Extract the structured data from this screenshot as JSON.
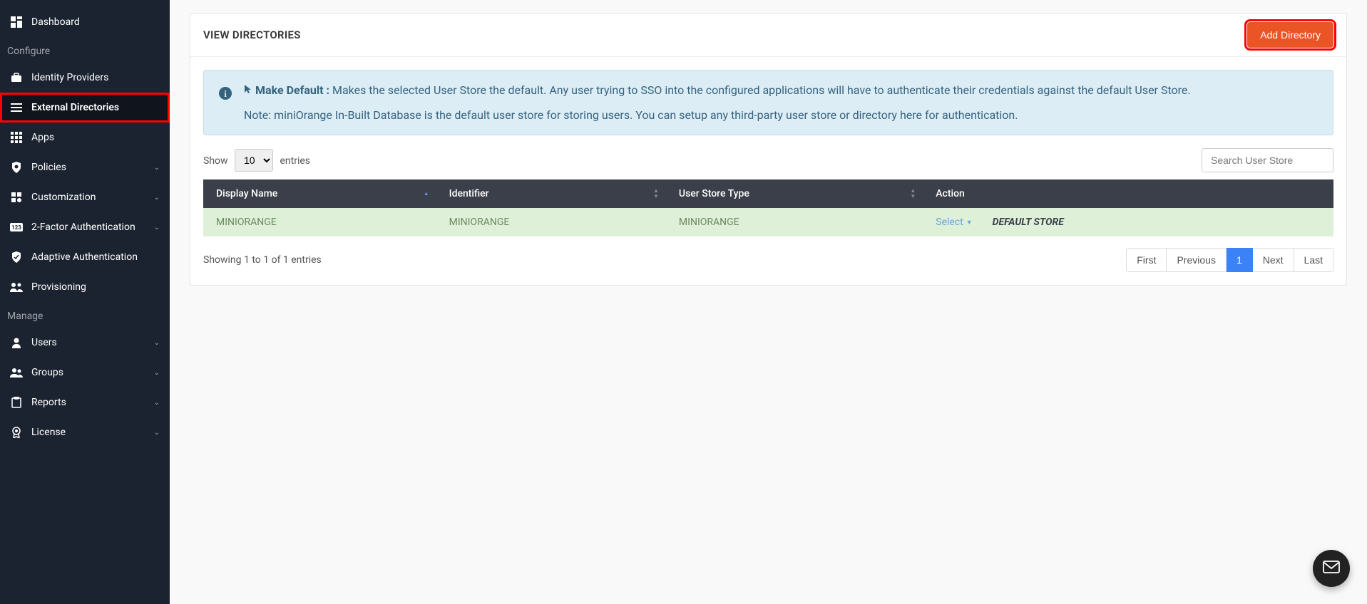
{
  "sidebar": {
    "dashboard": "Dashboard",
    "section_configure": "Configure",
    "section_manage": "Manage",
    "items": {
      "identity_providers": "Identity Providers",
      "external_directories": "External Directories",
      "apps": "Apps",
      "policies": "Policies",
      "customization": "Customization",
      "two_factor": "2-Factor Authentication",
      "adaptive_auth": "Adaptive Authentication",
      "provisioning": "Provisioning",
      "users": "Users",
      "groups": "Groups",
      "reports": "Reports",
      "license": "License"
    }
  },
  "header": {
    "title": "VIEW DIRECTORIES",
    "add_btn": "Add Directory"
  },
  "info": {
    "title_prefix": "Make Default :",
    "title_text": " Makes the selected User Store the default. Any user trying to SSO into the configured applications will have to authenticate their credentials against the default User Store.",
    "note": "Note: miniOrange In-Built Database is the default user store for storing users. You can setup any third-party user store or directory here for authentication."
  },
  "table": {
    "show_label": "Show",
    "entries_label": "entries",
    "entries_value": "10",
    "search_placeholder": "Search User Store",
    "columns": {
      "display_name": "Display Name",
      "identifier": "Identifier",
      "user_store_type": "User Store Type",
      "action": "Action"
    },
    "rows": [
      {
        "display_name": "MINIORANGE",
        "identifier": "MINIORANGE",
        "user_store_type": "MINIORANGE",
        "select_label": "Select",
        "badge": "DEFAULT STORE"
      }
    ],
    "footer_info": "Showing 1 to 1 of 1 entries",
    "pagination": {
      "first": "First",
      "previous": "Previous",
      "page1": "1",
      "next": "Next",
      "last": "Last"
    }
  }
}
